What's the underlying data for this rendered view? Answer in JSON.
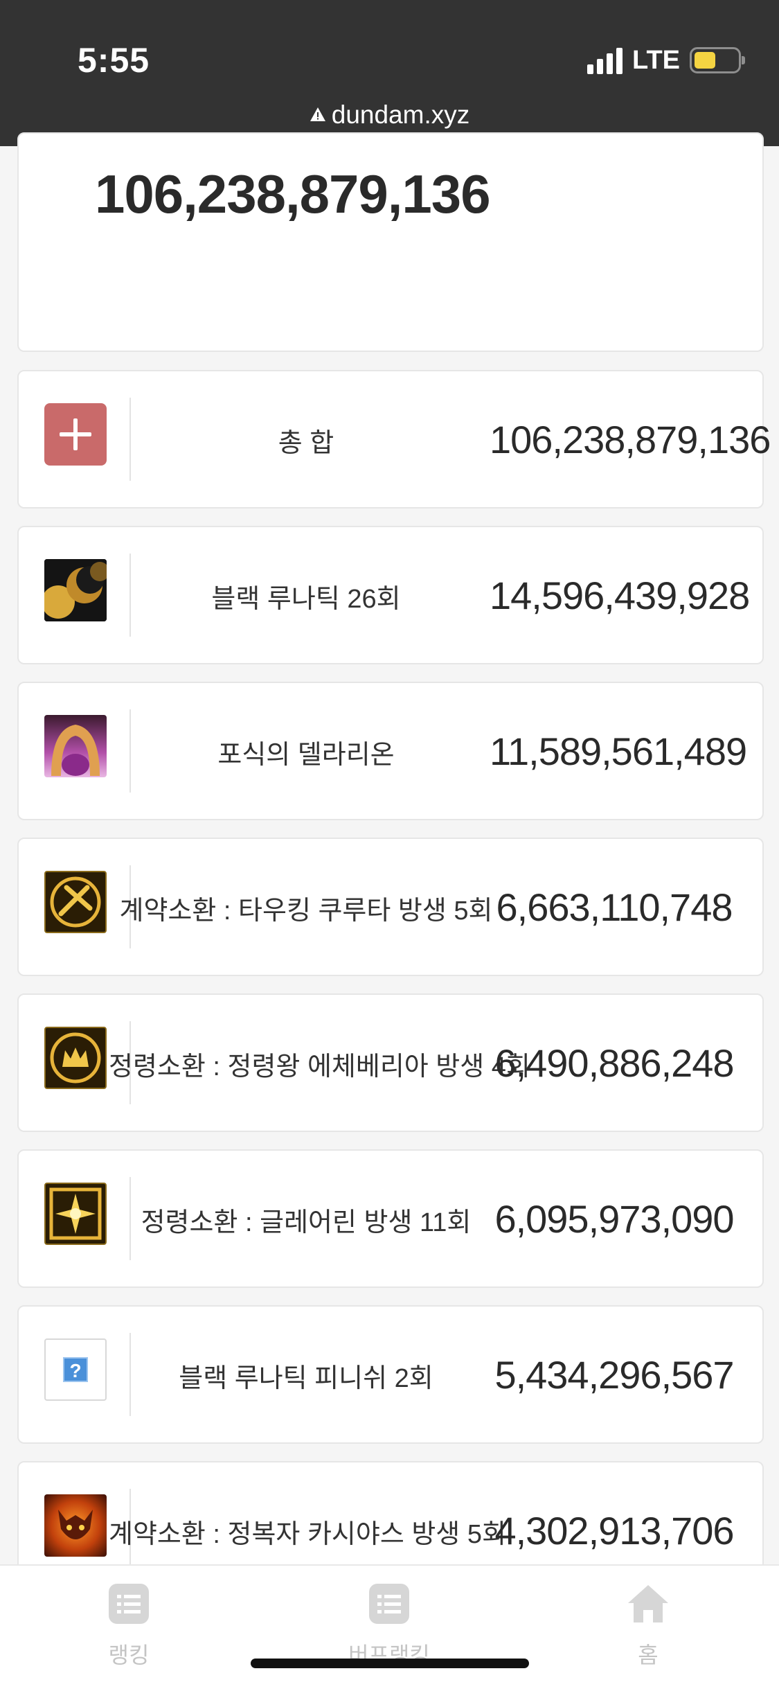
{
  "status_bar": {
    "time": "5:55",
    "network": "LTE",
    "url": "dundam.xyz"
  },
  "total_card": {
    "value": "106,238,879,136"
  },
  "rows": [
    {
      "icon": "plus-icon",
      "label": "총 합",
      "value": "106,238,879,136"
    },
    {
      "icon": "black-lunatic-skill-icon",
      "label": "블랙 루나틱 26회",
      "value": "14,596,439,928"
    },
    {
      "icon": "delirion-skill-icon",
      "label": "포식의 델라리온",
      "value": "11,589,561,489"
    },
    {
      "icon": "tauking-skill-icon",
      "label": "계약소환 : 타우킹 쿠루타 방생 5회",
      "value": "6,663,110,748"
    },
    {
      "icon": "echeveria-skill-icon",
      "label": "정령소환 : 정령왕 에체베리아 방생 4회",
      "value": "6,490,886,248"
    },
    {
      "icon": "glaerin-skill-icon",
      "label": "정령소환 : 글레어린 방생 11회",
      "value": "6,095,973,090"
    },
    {
      "icon": "unknown-skill-icon",
      "label": "블랙 루나틱 피니쉬 2회",
      "value": "5,434,296,567"
    },
    {
      "icon": "kasiyas-skill-icon",
      "label": "계약소환 : 정복자 카시야스 방생 5회",
      "value": "4,302,913,706"
    }
  ],
  "bottom_nav": {
    "items": [
      {
        "label": "랭킹",
        "icon": "list-icon"
      },
      {
        "label": "버프랭킹",
        "icon": "list-icon"
      },
      {
        "label": "홈",
        "icon": "home-icon"
      }
    ]
  },
  "colors": {
    "top_bar": "#333333",
    "plus_button": "#c96a6a",
    "battery": "#f5d442"
  }
}
